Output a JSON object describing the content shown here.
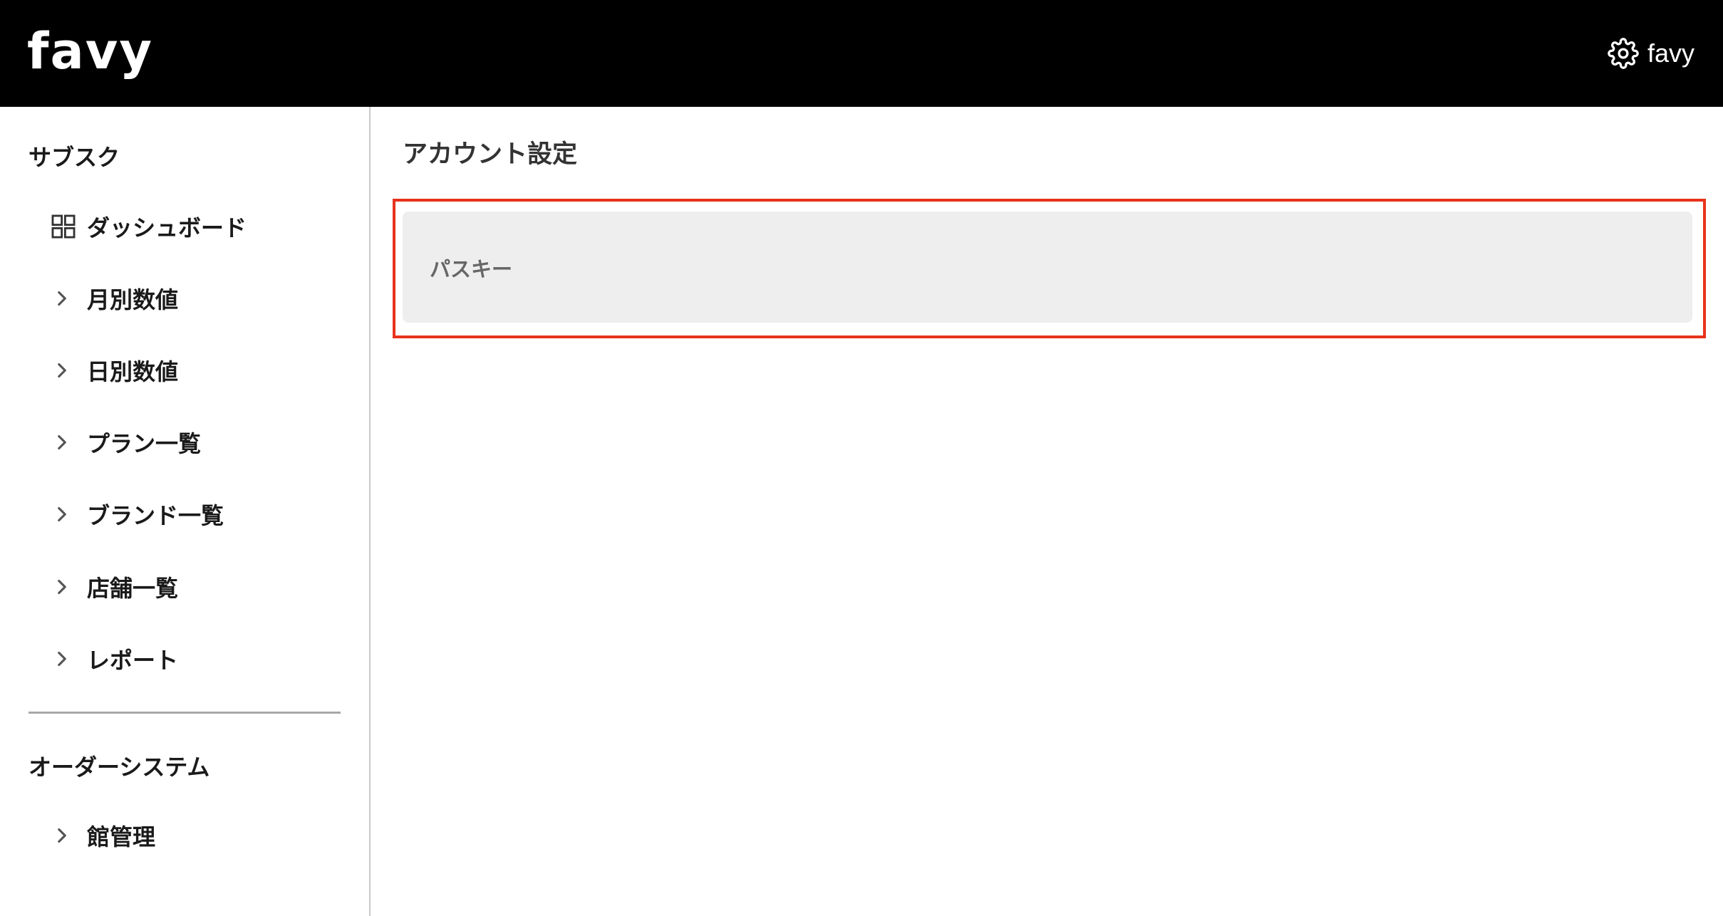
{
  "header": {
    "logo_text": "favy",
    "user_name": "favy",
    "settings_icon": "gear-icon",
    "background_color": "#000000"
  },
  "sidebar": {
    "sections": [
      {
        "title": "サブスク",
        "items": [
          {
            "label": "ダッシュボード",
            "icon": "grid-icon"
          },
          {
            "label": "月別数値",
            "icon": "chevron-right-icon"
          },
          {
            "label": "日別数値",
            "icon": "chevron-right-icon"
          },
          {
            "label": "プラン一覧",
            "icon": "chevron-right-icon"
          },
          {
            "label": "ブランド一覧",
            "icon": "chevron-right-icon"
          },
          {
            "label": "店舗一覧",
            "icon": "chevron-right-icon"
          },
          {
            "label": "レポート",
            "icon": "chevron-right-icon"
          }
        ]
      },
      {
        "title": "オーダーシステム",
        "items": [
          {
            "label": "館管理",
            "icon": "chevron-right-icon"
          }
        ]
      }
    ]
  },
  "main": {
    "title": "アカウント設定",
    "cards": [
      {
        "label": "パスキー"
      }
    ],
    "highlight_color": "#e8321c"
  }
}
